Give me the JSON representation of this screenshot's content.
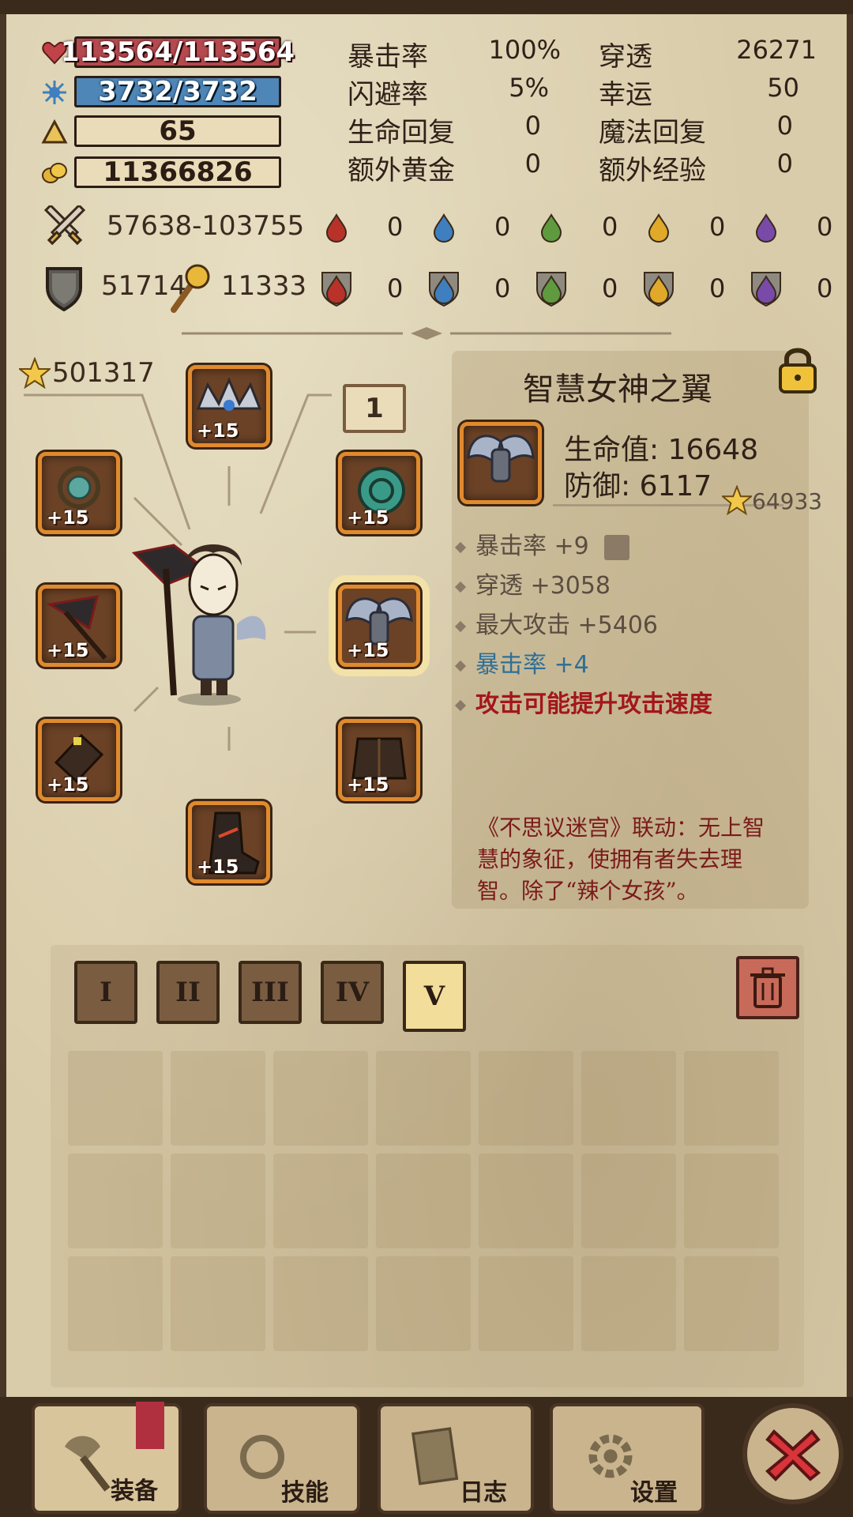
{
  "resources": {
    "hp": "113564/113564",
    "mp": "3732/3732",
    "level": "65",
    "gold": "11366826"
  },
  "stats": [
    {
      "label": "暴击率",
      "value": "100%"
    },
    {
      "label": "闪避率",
      "value": "5%"
    },
    {
      "label": "生命回复",
      "value": "0"
    },
    {
      "label": "额外黄金",
      "value": "0"
    },
    {
      "label": "穿透",
      "value": "26271"
    },
    {
      "label": "幸运",
      "value": "50"
    },
    {
      "label": "魔法回复",
      "value": "0"
    },
    {
      "label": "额外经验",
      "value": "0"
    }
  ],
  "attack": "57638-103755",
  "defense": "51714",
  "magic_power": "11333",
  "elements_attack": [
    "0",
    "0",
    "0",
    "0",
    "0"
  ],
  "elements_defense": [
    "0",
    "0",
    "0",
    "0",
    "0"
  ],
  "element_colors": [
    "#b8322a",
    "#3f7fbf",
    "#5f9a3e",
    "#e0a92a",
    "#7a4aa8"
  ],
  "score": "501317",
  "page_indicator": "1",
  "equipment_levels": {
    "head": "+15",
    "amulet": "+15",
    "ring": "+15",
    "weapon": "+15",
    "armor": "+15",
    "gloves": "+15",
    "chest": "+15",
    "boots": "+15"
  },
  "item": {
    "name": "智慧女神之翼",
    "locked": true,
    "hp_line": "生命值: 16648",
    "def_line": "防御: 6117",
    "score": "64933",
    "attributes": [
      {
        "text": "暴击率 +9",
        "color": "#5b4d41"
      },
      {
        "text": "穿透 +3058",
        "color": "#5b4d41"
      },
      {
        "text": "最大攻击 +5406",
        "color": "#5b4d41"
      },
      {
        "text": "暴击率 +4",
        "color": "#2f6f96"
      },
      {
        "text": "攻击可能提升攻击速度",
        "color": "#a3161c"
      }
    ],
    "lore": "《不思议迷宫》联动：无上智慧的象征，使拥有者失去理智。除了“辣个女孩”。"
  },
  "bag_tabs": [
    "I",
    "II",
    "III",
    "IV",
    "V"
  ],
  "active_bag_tab": 4,
  "nav": {
    "equip": "装备",
    "skills": "技能",
    "log": "日志",
    "settings": "设置"
  },
  "icons": {
    "hp": "heart-icon",
    "mp": "mana-sparkle-icon",
    "level": "triangle-level-icon",
    "gold": "gold-coins-icon",
    "attack": "crossed-swords-icon",
    "defense": "shield-icon",
    "magic": "magic-staff-icon",
    "lock": "padlock-icon",
    "trash": "trash-can-icon",
    "close": "close-x-icon"
  }
}
